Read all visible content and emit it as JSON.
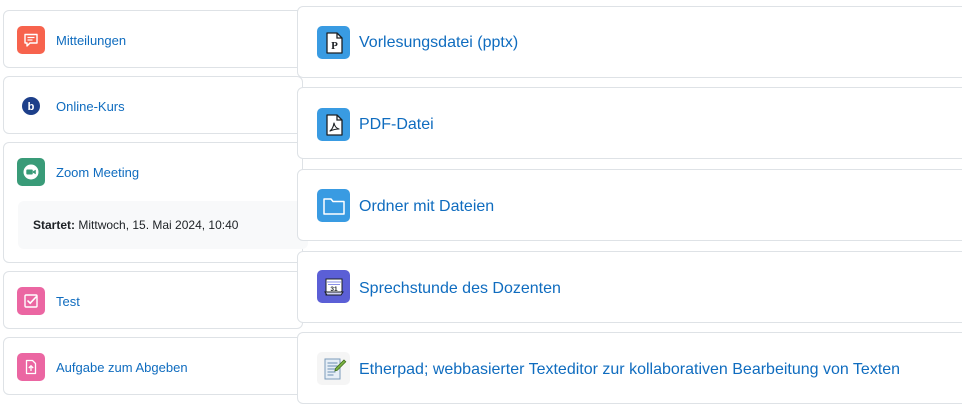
{
  "left_activities": [
    {
      "label": "Mitteilungen",
      "icon": "forum-icon",
      "color": "#f7634d"
    },
    {
      "label": "Online-Kurs",
      "icon": "bigbluebutton-icon",
      "color": "#ffffff"
    },
    {
      "label": "Zoom Meeting",
      "icon": "zoom-video-icon",
      "color": "#399b78",
      "detail_label": "Startet:",
      "detail_value": "Mittwoch, 15. Mai 2024, 10:40"
    },
    {
      "label": "Test",
      "icon": "quiz-icon",
      "color": "#eb66a2"
    },
    {
      "label": "Aufgabe zum Abgeben",
      "icon": "assignment-icon",
      "color": "#eb66a2"
    }
  ],
  "right_activities": [
    {
      "label": "Vorlesungsdatei (pptx)",
      "icon": "powerpoint-file-icon",
      "color": "#399be2"
    },
    {
      "label": "PDF-Datei",
      "icon": "pdf-file-icon",
      "color": "#399be2"
    },
    {
      "label": "Ordner mit Dateien",
      "icon": "folder-icon",
      "color": "#399be2"
    },
    {
      "label": "Sprechstunde des Dozenten",
      "icon": "scheduler-calendar-icon",
      "color": "#5b5fd6"
    },
    {
      "label": "Etherpad; webbasierter Texteditor zur kollaborativen Bearbeitung von Texten",
      "icon": "etherpad-notepad-icon",
      "color": "#f5f5f5"
    }
  ],
  "colors": {
    "link": "#0f6cbf",
    "border": "#dee2e6",
    "detail_bg": "#f8f9fa"
  }
}
